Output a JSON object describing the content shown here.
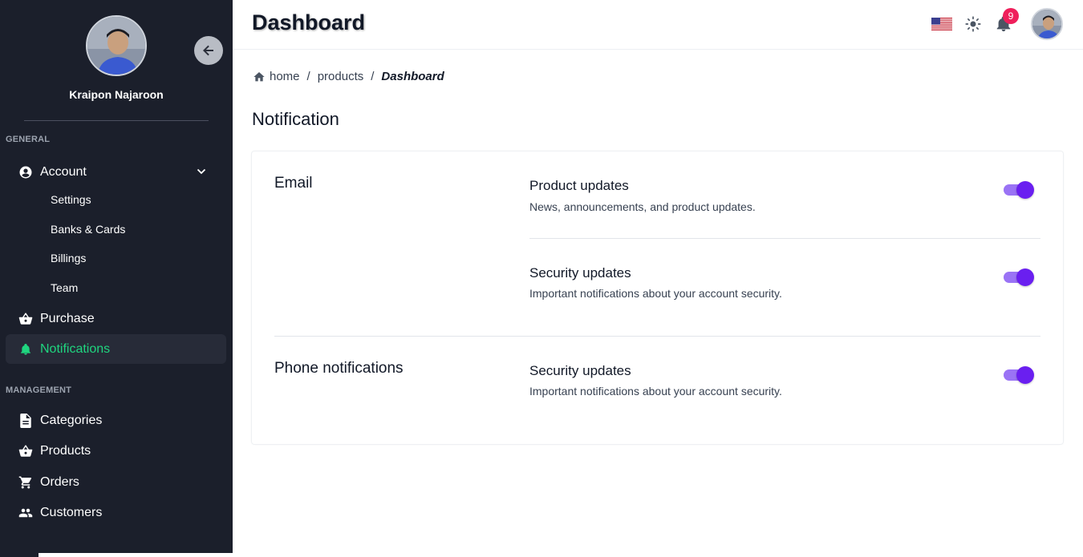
{
  "user": {
    "name": "Kraipon Najaroon"
  },
  "sidebar": {
    "general_label": "GENERAL",
    "management_label": "MANAGEMENT",
    "account": {
      "label": "Account",
      "children": [
        "Settings",
        "Banks & Cards",
        "Billings",
        "Team"
      ]
    },
    "purchase_label": "Purchase",
    "notifications_label": "Notifications",
    "management_items": [
      "Categories",
      "Products",
      "Orders",
      "Customers"
    ],
    "active_color": "#1fd57f"
  },
  "topbar": {
    "title": "Dashboard",
    "notification_count": "9",
    "icons": [
      "us-flag-icon",
      "sun-icon",
      "bell-icon"
    ]
  },
  "breadcrumb": {
    "items": [
      "home",
      "products"
    ],
    "current": "Dashboard",
    "separator": "/"
  },
  "page": {
    "section_title": "Notification"
  },
  "notifications": {
    "email": {
      "title": "Email",
      "items": [
        {
          "title": "Product updates",
          "description": "News, announcements, and product updates.",
          "enabled": true
        },
        {
          "title": "Security updates",
          "description": "Important notifications about your account security.",
          "enabled": true
        }
      ]
    },
    "phone": {
      "title": "Phone notifications",
      "items": [
        {
          "title": "Security updates",
          "description": "Important notifications about your account security.",
          "enabled": true
        }
      ]
    }
  },
  "colors": {
    "sidebar_bg": "#1b1f2b",
    "toggle_thumb": "#6a1ff0",
    "toggle_track": "#9a73f5",
    "badge": "#ef1f5b"
  }
}
